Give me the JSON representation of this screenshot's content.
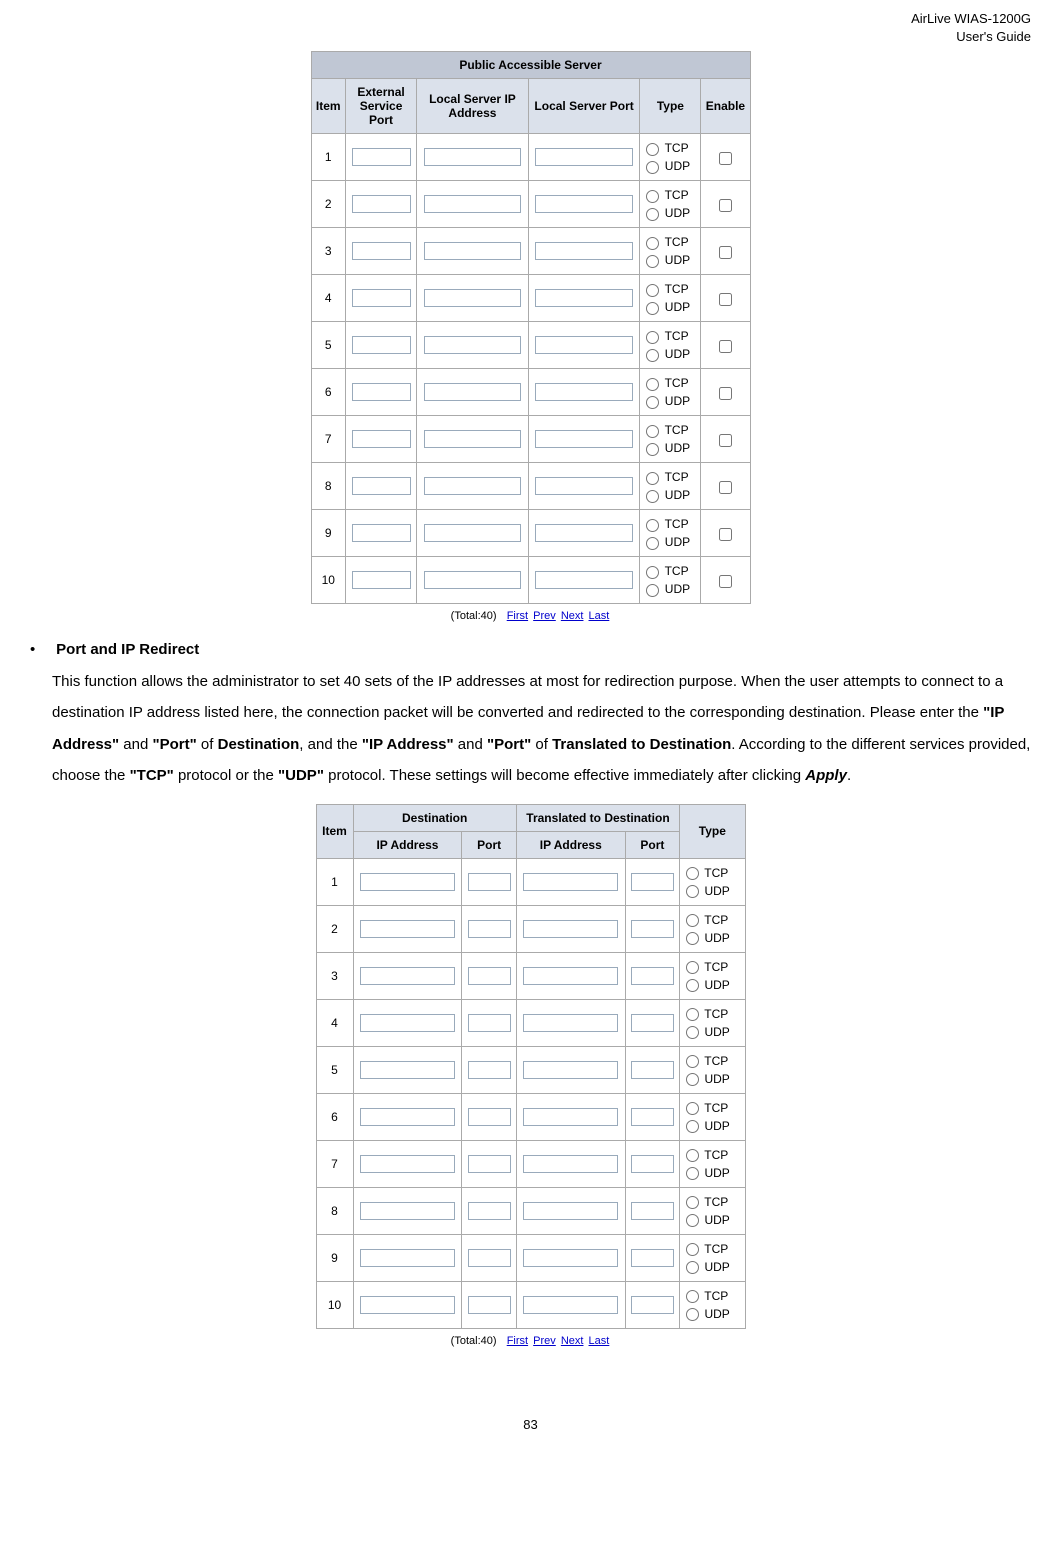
{
  "header": {
    "line1": "AirLive WIAS-1200G",
    "line2": "User's Guide"
  },
  "table1": {
    "title": "Public Accessible Server",
    "headers": {
      "item": "Item",
      "ext_port": "External Service Port",
      "ip": "Local Server IP Address",
      "local_port": "Local Server Port",
      "type": "Type",
      "enable": "Enable"
    },
    "type_tcp": "TCP",
    "type_udp": "UDP",
    "rows": [
      "1",
      "2",
      "3",
      "4",
      "5",
      "6",
      "7",
      "8",
      "9",
      "10"
    ]
  },
  "pager": {
    "total": "(Total:40)",
    "first": "First",
    "prev": "Prev",
    "next": "Next",
    "last": "Last"
  },
  "section": {
    "bullet": "•",
    "title": "Port and IP Redirect",
    "p1a": "This function allows the administrator to set 40 sets of the IP addresses at most for redirection purpose. When the user attempts to connect to a destination IP address listed here, the connection packet will be converted and redirected to the corresponding destination. Please enter the ",
    "b1": "\"IP Address\"",
    "p1b": " and ",
    "b2": "\"Port\"",
    "p1c": " of ",
    "b3": "Destination",
    "p1d": ", and the ",
    "b4": "\"IP Address\"",
    "p1e": " and ",
    "b5": "\"Port\"",
    "p1f": " of ",
    "b6": "Translated to Destination",
    "p1g": ". According to the different services provided, choose the ",
    "b7": "\"TCP\"",
    "p1h": " protocol or the ",
    "b8": "\"UDP\"",
    "p1i": " protocol. These settings will become effective immediately after clicking ",
    "b9": "Apply",
    "p1j": "."
  },
  "table2": {
    "headers": {
      "item": "Item",
      "dest": "Destination",
      "trans": "Translated to Destination",
      "type": "Type",
      "ip": "IP Address",
      "port": "Port"
    },
    "type_tcp": "TCP",
    "type_udp": "UDP",
    "rows": [
      "1",
      "2",
      "3",
      "4",
      "5",
      "6",
      "7",
      "8",
      "9",
      "10"
    ]
  },
  "page_number": "83"
}
